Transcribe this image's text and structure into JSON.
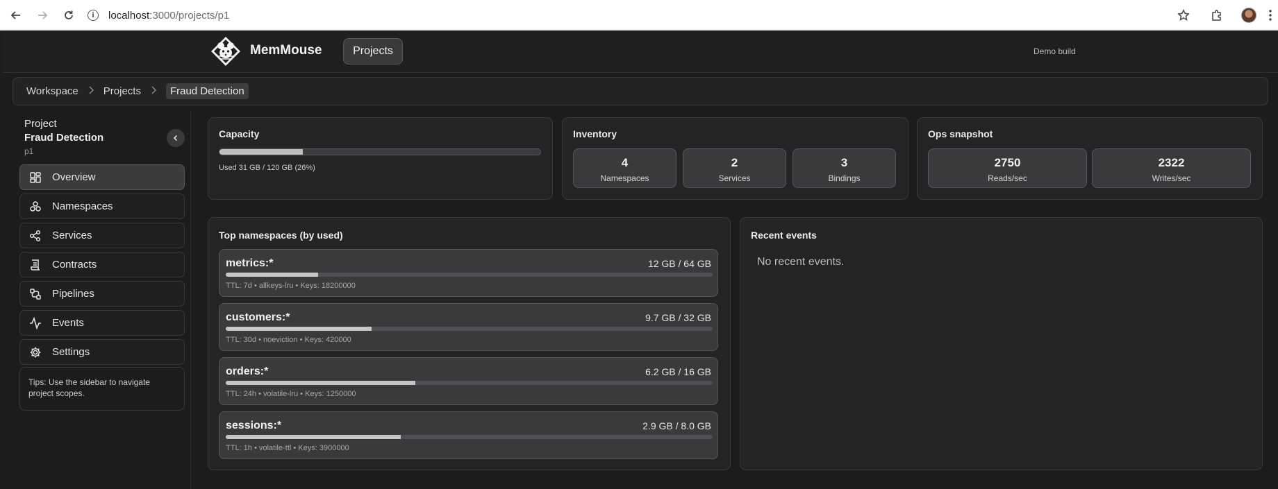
{
  "browser": {
    "url_host": "localhost",
    "url_rest": ":3000/projects/p1"
  },
  "app": {
    "brand": "MemMouse",
    "projects_button": "Projects",
    "build_label": "Demo build"
  },
  "breadcrumb": [
    "Workspace",
    "Projects",
    "Fraud Detection"
  ],
  "sidebar": {
    "heading": "Project",
    "project_name": "Fraud Detection",
    "project_id": "p1",
    "items": [
      {
        "label": "Overview",
        "icon": "dashboard-icon",
        "active": true
      },
      {
        "label": "Namespaces",
        "icon": "namespaces-icon"
      },
      {
        "label": "Services",
        "icon": "share-icon"
      },
      {
        "label": "Contracts",
        "icon": "contract-icon"
      },
      {
        "label": "Pipelines",
        "icon": "pipeline-icon"
      },
      {
        "label": "Events",
        "icon": "activity-icon"
      },
      {
        "label": "Settings",
        "icon": "gear-icon"
      }
    ],
    "tips": "Tips: Use the sidebar to navigate project scopes."
  },
  "capacity": {
    "title": "Capacity",
    "used_fraction": 0.26,
    "note": "Used 31 GB / 120 GB (26%)"
  },
  "inventory": {
    "title": "Inventory",
    "stats": [
      {
        "value": "4",
        "label": "Namespaces"
      },
      {
        "value": "2",
        "label": "Services"
      },
      {
        "value": "3",
        "label": "Bindings"
      }
    ]
  },
  "ops": {
    "title": "Ops snapshot",
    "stats": [
      {
        "value": "2750",
        "label": "Reads/sec"
      },
      {
        "value": "2322",
        "label": "Writes/sec"
      }
    ]
  },
  "top_namespaces": {
    "title": "Top namespaces (by used)",
    "items": [
      {
        "name": "metrics:*",
        "usage": "12 GB / 64 GB",
        "fraction": 0.19,
        "meta": "TTL: 7d • allkeys-lru • Keys: 18200000"
      },
      {
        "name": "customers:*",
        "usage": "9.7 GB / 32 GB",
        "fraction": 0.3,
        "meta": "TTL: 30d • noeviction • Keys: 420000"
      },
      {
        "name": "orders:*",
        "usage": "6.2 GB / 16 GB",
        "fraction": 0.39,
        "meta": "TTL: 24h • volatile-lru • Keys: 1250000"
      },
      {
        "name": "sessions:*",
        "usage": "2.9 GB / 8.0 GB",
        "fraction": 0.36,
        "meta": "TTL: 1h • volatile-ttl • Keys: 3900000"
      }
    ]
  },
  "recent_events": {
    "title": "Recent events",
    "empty": "No recent events."
  }
}
